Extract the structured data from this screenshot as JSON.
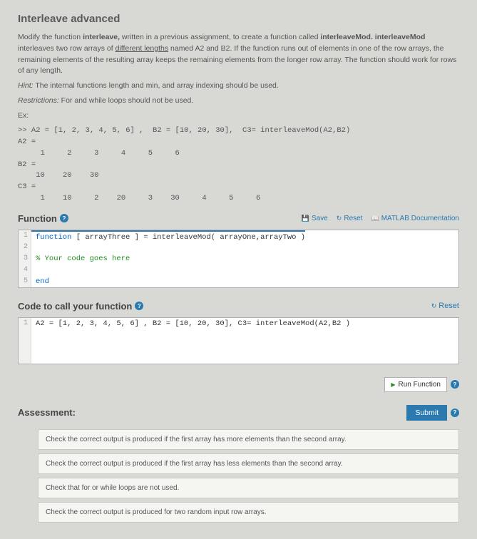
{
  "title": "Interleave advanced",
  "intro": {
    "p1a": "Modify the function ",
    "p1b": "interleave,",
    "p1c": " written in a previous assignment, to create a function called ",
    "p1d": "interleaveMod.",
    "p2a": "interleaveMod ",
    "p2b": "interleaves two row arrays of ",
    "p2c": "different lengths",
    "p2d": " named A2 and B2. If the function runs out of elements in one of the row arrays, the remaining elements of the resulting array keeps the remaining elements from the longer row array. The function should work for rows of any length.",
    "hint_label": "Hint:",
    "hint_text": " The internal functions length and min, and array indexing should be used.",
    "restrictions_label": "Restrictions:",
    "restrictions_text": " For and while loops should not be used.",
    "ex_label": "Ex:"
  },
  "example_code": ">> A2 = [1, 2, 3, 4, 5, 6] ,  B2 = [10, 20, 30],  C3= interleaveMod(A2,B2)\nA2 =\n     1     2     3     4     5     6\nB2 =\n    10    20    30\nC3 =\n     1    10     2    20     3    30     4     5     6",
  "function_section": {
    "title": "Function",
    "save": "Save",
    "reset": "Reset",
    "doc": "MATLAB Documentation"
  },
  "editor": {
    "l1a": "function",
    "l1b": " [ arrayThree ] = interleaveMod( arrayOne,arrayTwo )",
    "l3": "% Your code goes here",
    "l5": "end"
  },
  "code_call": {
    "title": "Code to call your function",
    "reset": "Reset",
    "line": "A2 = [1, 2, 3, 4, 5, 6] ,  B2 = [10, 20, 30],  C3= interleaveMod(A2,B2 )"
  },
  "run_btn": "Run Function",
  "assessment": {
    "title": "Assessment:",
    "submit": "Submit",
    "checks": [
      "Check the correct output is produced if the first array has more elements than the second array.",
      "Check the correct output is produced if the first array has less elements than the second array.",
      "Check that for or while loops are not used.",
      "Check the correct output is produced for two random input row arrays."
    ]
  }
}
